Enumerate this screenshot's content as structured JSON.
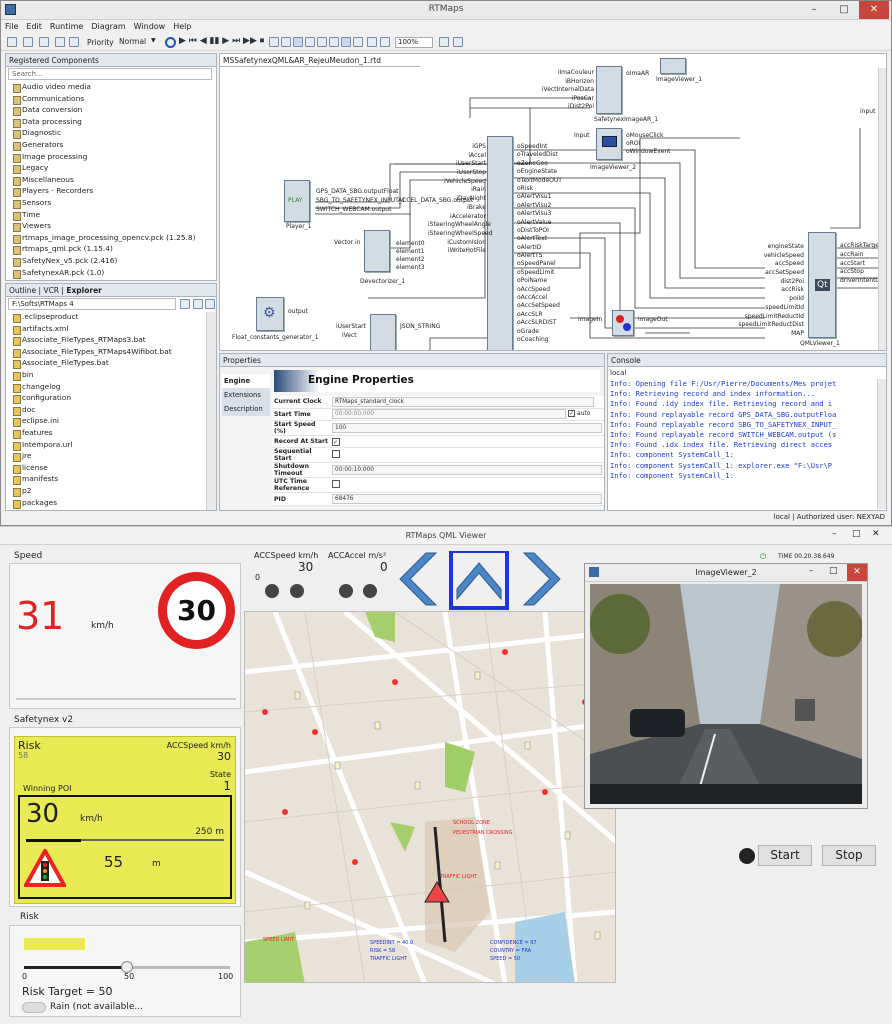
{
  "rtmaps": {
    "title": "RTMaps",
    "menu": [
      "File",
      "Edit",
      "Runtime",
      "Diagram",
      "Window",
      "Help"
    ],
    "priority_label": "Priority",
    "priority_value": "Normal",
    "zoom": "100%",
    "registered_tab": "Registered Components",
    "search_placeholder": "Search...",
    "components": [
      "Audio video media",
      "Communications",
      "Data conversion",
      "Data processing",
      "Diagnostic",
      "Generators",
      "Image processing",
      "Legacy",
      "Miscellaneous",
      "Players - Recorders",
      "Sensors",
      "Time",
      "Viewers",
      "rtmaps_image_processing_opencv.pck (1.25.8)",
      "rtmaps_qml.pck (1.15.4)",
      "SafetyNex_v5.pck (2.416)",
      "SafetynexAR.pck (1.0)"
    ],
    "bottom_tabs": [
      "Outline",
      "VCR",
      "Explorer"
    ],
    "explorer_path": "F:\\Softs\\RTMaps 4",
    "files": [
      ".eclipseproduct",
      "artifacts.xml",
      "Associate_FileTypes_RTMaps3.bat",
      "Associate_FileTypes_RTMaps4Wifibot.bat",
      "Associate_FileTypes.bat",
      "bin",
      "changelog",
      "configuration",
      "doc",
      "eclipse.ini",
      "features",
      "Intempora.url",
      "jre",
      "license",
      "manifests",
      "p2",
      "packages"
    ],
    "diagram_tab": "MSSafetynexQML&AR_RejeuMeudon_1.rtd",
    "blocks": {
      "player": "Player_1",
      "play": "PLAY",
      "devectorizer": "Devectorizer_1",
      "floatgen": "Float_constants_generator_1",
      "safetynexar": "SafetynexImageAR_1",
      "imageviewer1": "ImageViewer_1",
      "imageviewer2": "ImageViewer_2",
      "qml": "QMLViewer_1",
      "input": "input",
      "output": "output",
      "vectorin": "Vector in",
      "imagein": "imageIn",
      "imageout": "imageOut",
      "inputpin": "Input",
      "omaar": "oImaAR",
      "qt": "Qt"
    },
    "player_outputs": [
      "GPS_DATA_SBG.outputFloat",
      "SBG_TO_SAFETYNEX_INPUT_1",
      "SWITCH_WEBCAM.output"
    ],
    "accel_label": "ACCEL_DATA_SBG.output",
    "dev_outputs": [
      "element0",
      "element1",
      "element2",
      "element3"
    ],
    "ar_inputs": [
      "iImaCouleur",
      "iBHorizon",
      "iVectInternalData",
      "iPosCar",
      "iDist2Poi"
    ],
    "iv2_outputs": [
      "oMouseClick",
      "oROI",
      "oWindowEvent"
    ],
    "snx_inputs": [
      "iGPS",
      "iAccel",
      "iUserStart",
      "iUserStop",
      "iVehicleSpeed",
      "iRain",
      "iDayNight",
      "iBrake",
      "iAccelerator",
      "iSteeringWheelAngle",
      "iSteeringWheelSpeed",
      "iCustomIsIon",
      "iWriteHotFile"
    ],
    "snx_outputs": [
      "oSpeedInt",
      "oTraveledDist",
      "oZoneGeo",
      "oEngineState",
      "oTextModeOUT",
      "oRisk",
      "oAlertVisu1",
      "oAlertVisu2",
      "oAlertVisu3",
      "oAlertValue",
      "oDistToPOI",
      "oAlertText",
      "oAlertID",
      "oAlertTS",
      "oSpeedPanel",
      "oSpeedLimit",
      "oPoiName",
      "oAccSpeed",
      "oAccAccel",
      "oAccSetSpeed",
      "oAccSLR",
      "oAccSLRDIST",
      "oGrade",
      "oCoaching"
    ],
    "qml_inputs": [
      "engineState",
      "vehicleSpeed",
      "accSpeed",
      "accSetSpeed",
      "dist2Poi",
      "accRisk",
      "poiId",
      "speedLimitId",
      "speedLimitReductId",
      "speedLimitReductDist",
      "MAP"
    ],
    "qml_outputs": [
      "accRiskTarget",
      "accRain",
      "accStart",
      "accStop",
      "driverIntentO"
    ],
    "float_inputs": [
      "iUserStart",
      "iVect"
    ],
    "json": "JSON_STRING",
    "properties_tab": "Properties",
    "prop_tabs": [
      "Engine",
      "Extensions",
      "Description"
    ],
    "prop_title": "Engine Properties",
    "props": [
      {
        "k": "Current Clock",
        "v": "RTMaps_standard_clock"
      },
      {
        "k": "Start Time",
        "v": "00:00:00.000"
      },
      {
        "k": "Start Speed (%)",
        "v": "100"
      },
      {
        "k": "Record At Start",
        "v": ""
      },
      {
        "k": "Sequential Start",
        "v": ""
      },
      {
        "k": "Shutdown Timeout",
        "v": "00:00:10.000"
      },
      {
        "k": "UTC Time Reference",
        "v": ""
      },
      {
        "k": "PID",
        "v": "68476"
      }
    ],
    "auto_label": "auto",
    "console_tab": "Console",
    "console_local": "local",
    "console_lines": [
      "Info: Opening file F:/Usr/Pierre/Documents/Mes projet",
      "Info: Retrieving record and index information...",
      "Info: Found .idy index file. Retrieving record and i",
      "Info: Found replayable record GPS_DATA_SBG.outputFloa",
      "Info: Found replayable record SBG_TO_SAFETYNEX_INPUT_",
      "Info: Found replayable record SWITCH_WEBCAM.output (s",
      "Info: Found .idx index file. Retrieving direct acces",
      "Info: component SystemCall_1:",
      "Info: component SystemCall_1: explorer.exe \"F:\\Usr\\P",
      "Info: component SystemCall_1:"
    ],
    "status": "local | Authorized user: NEXYAD"
  },
  "qml": {
    "title": "RTMaps QML Viewer",
    "speed_label": "Speed",
    "speed_value": "31",
    "speed_unit": "km/h",
    "sign_limit": "30",
    "acc_speed_label": "ACCSpeed km/h",
    "acc_speed_value": "30",
    "acc_accel_label": "ACCAccel m/s²",
    "acc_accel_value": "0",
    "acc_zero": "0",
    "time": "TIME 00.20.38.649",
    "safetynex_label": "Safetynex v2",
    "risk_title": "Risk",
    "risk_value": "58",
    "acc_speed2_label": "ACCSpeed km/h",
    "acc_speed2_value": "30",
    "state_label": "State",
    "state_value": "1",
    "winning_poi": "Winning POI",
    "poi_speed": "30",
    "poi_unit": "km/h",
    "poi_dist": "250 m",
    "poi_dist2": "55",
    "poi_dist2_unit": "m",
    "risk_section": "Risk",
    "risk_fill": 0.34,
    "slider_min": "0",
    "slider_mid": "50",
    "slider_max": "100",
    "slider_value": 0.5,
    "risk_target": "Risk Target = 50",
    "rain_label": "Rain (not available...",
    "imageviewer_title": "ImageViewer_2",
    "start": "Start",
    "stop": "Stop",
    "map_labels": [
      "SPEED LIMIT",
      "SCHOOL ZONE",
      "PEDESTRIAN CROSSING",
      "TRAFFIC LIGHT",
      "SPEEDINT = 40.0",
      "RISK = 58",
      "TRAFFIC LIGHT",
      "CONFIDENCE = 97",
      "COUNTRY = FRA",
      "SPEED = 50"
    ]
  },
  "colors": {
    "accent_blue": "#1a36d8",
    "yellow": "#e9ea54",
    "red": "#e22222",
    "qml_nav_blue": "#4a86c8"
  }
}
